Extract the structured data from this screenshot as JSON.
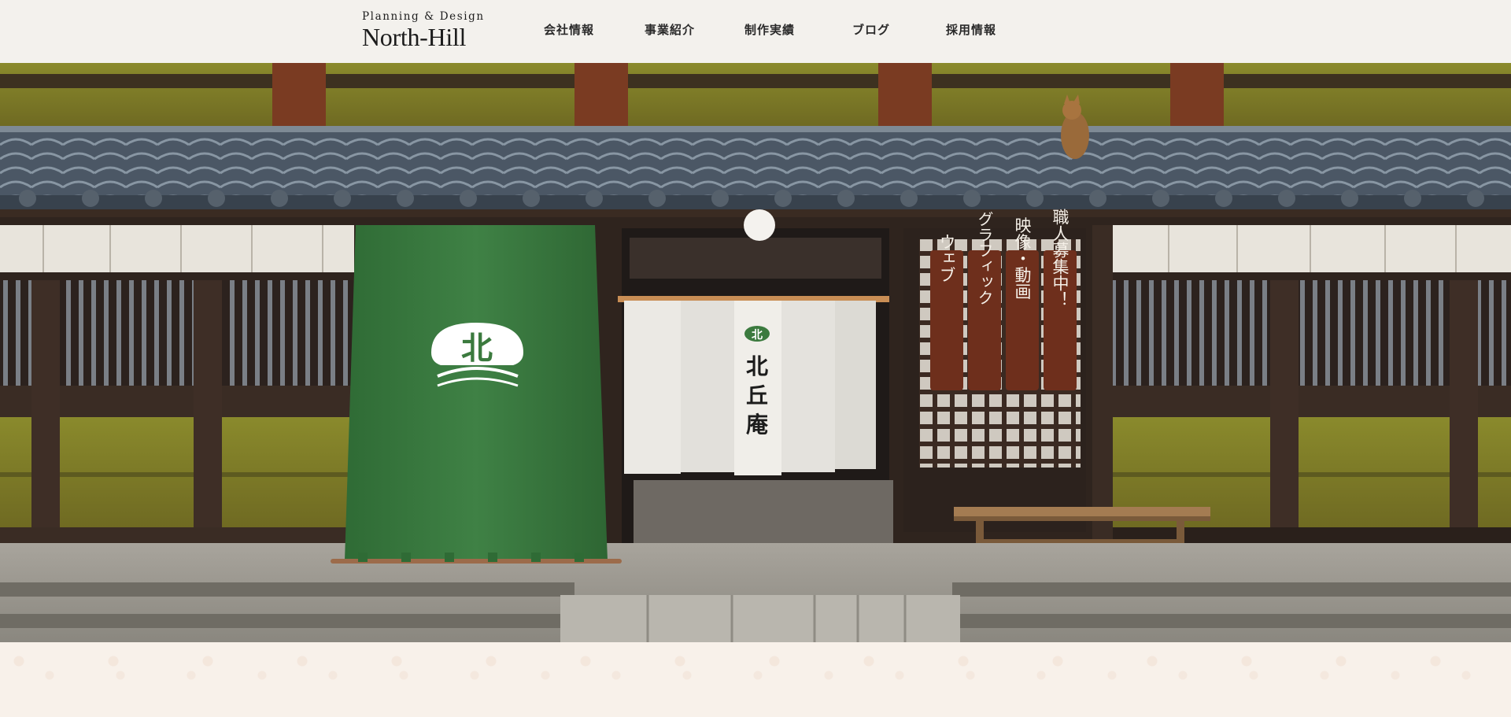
{
  "header": {
    "logo": {
      "sub": "Planning & Design",
      "main": "North-Hill"
    },
    "nav": [
      {
        "label": "会社情報"
      },
      {
        "label": "事業紹介"
      },
      {
        "label": "制作実績"
      },
      {
        "label": "ブログ"
      },
      {
        "label": "採用情報"
      }
    ]
  },
  "hero": {
    "green_curtain": {
      "emblem_char": "北",
      "color": "#3b7a3e"
    },
    "noren": {
      "chars": [
        "北",
        "丘",
        "庵"
      ],
      "emblem_char": "北"
    },
    "signboards": [
      {
        "text": "職人募集中！"
      },
      {
        "text": "映像・動画"
      },
      {
        "text": "グラフィック"
      },
      {
        "text": "ウェブ"
      }
    ]
  },
  "colors": {
    "header_bg": "#f3f1ed",
    "wall": "#7a7228",
    "wood": "#4a342a",
    "roof": "#4a5868",
    "curtain_green": "#3b7a3e",
    "signboard": "#6e2f1c"
  }
}
